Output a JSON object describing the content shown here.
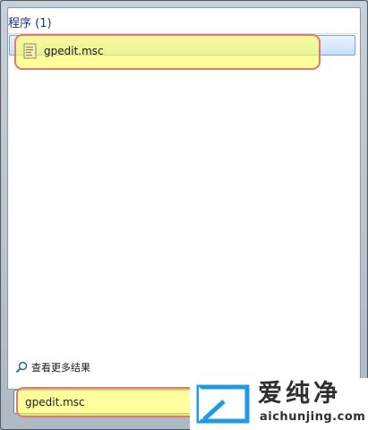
{
  "section": {
    "title": "程序 (1)"
  },
  "results": [
    {
      "label": "gpedit.msc",
      "icon": "msc-file-icon"
    }
  ],
  "more_results": {
    "label": "查看更多结果",
    "icon": "search-icon"
  },
  "search": {
    "value": "gpedit.msc"
  },
  "watermark": {
    "name": "爱纯净",
    "url": "aichunjing.com",
    "icon": "logo-icon"
  },
  "colors": {
    "highlight_fill": "#ffff60",
    "highlight_border": "#e07a6e",
    "section_title": "#1e3287"
  }
}
